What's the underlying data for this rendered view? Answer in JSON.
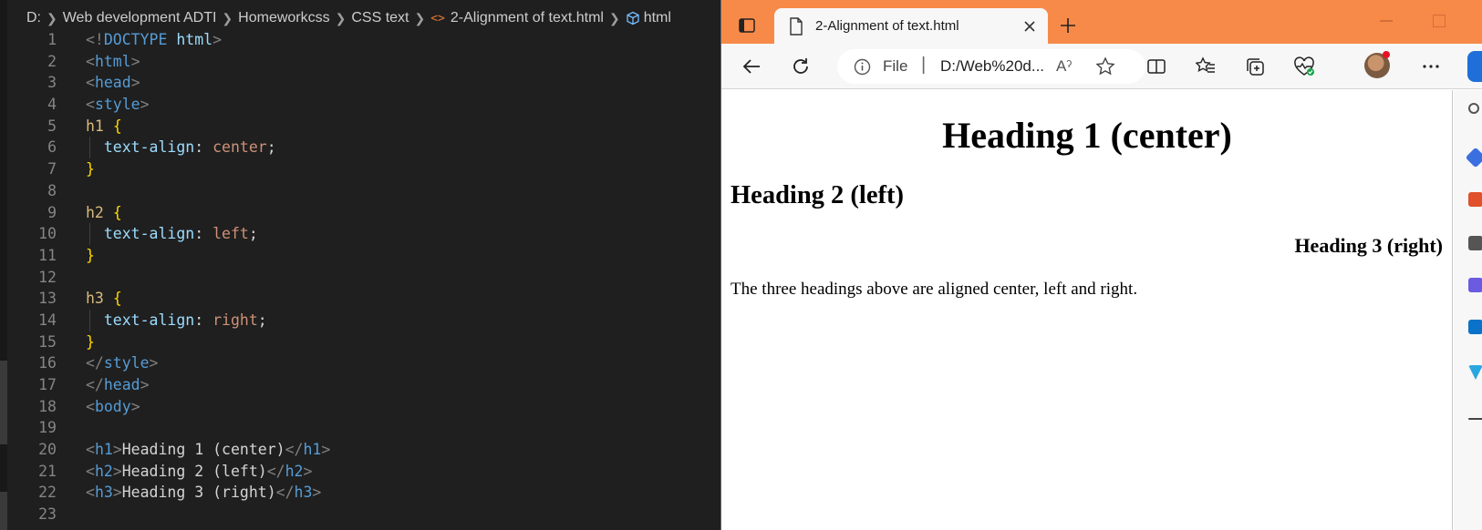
{
  "editor": {
    "breadcrumb": {
      "drive": "D:",
      "folder1": "Web development ADTI",
      "folder2": "Homeworkcss",
      "folder3": "CSS text",
      "file": "2-Alignment of text.html",
      "symbol": "html"
    },
    "code_lines": [
      {
        "n": "1",
        "text": "<!DOCTYPE html>"
      },
      {
        "n": "2",
        "text": "<html>"
      },
      {
        "n": "3",
        "text": "<head>"
      },
      {
        "n": "4",
        "text": "<style>"
      },
      {
        "n": "5",
        "text": "h1 {"
      },
      {
        "n": "6",
        "text": "  text-align: center;"
      },
      {
        "n": "7",
        "text": "}"
      },
      {
        "n": "8",
        "text": ""
      },
      {
        "n": "9",
        "text": "h2 {"
      },
      {
        "n": "10",
        "text": "  text-align: left;"
      },
      {
        "n": "11",
        "text": "}"
      },
      {
        "n": "12",
        "text": ""
      },
      {
        "n": "13",
        "text": "h3 {"
      },
      {
        "n": "14",
        "text": "  text-align: right;"
      },
      {
        "n": "15",
        "text": "}"
      },
      {
        "n": "16",
        "text": "</style>"
      },
      {
        "n": "17",
        "text": "</head>"
      },
      {
        "n": "18",
        "text": "<body>"
      },
      {
        "n": "19",
        "text": ""
      },
      {
        "n": "20",
        "text": "<h1>Heading 1 (center)</h1>"
      },
      {
        "n": "21",
        "text": "<h2>Heading 2 (left)</h2>"
      },
      {
        "n": "22",
        "text": "<h3>Heading 3 (right)</h3>"
      },
      {
        "n": "23",
        "text": ""
      }
    ]
  },
  "browser": {
    "tab_title": "2-Alignment of text.html",
    "address": {
      "scheme_label": "File",
      "separator": "|",
      "url": "D:/Web%20d...",
      "read_aloud": "Aˀ"
    },
    "page": {
      "h1": "Heading 1 (center)",
      "h2": "Heading 2 (left)",
      "h3": "Heading 3 (right)",
      "paragraph": "The three headings above are aligned center, left and right."
    },
    "colors": {
      "titlebar": "#f78a49",
      "toolbar": "#f7f7f7"
    },
    "icons": [
      "tab-actions-icon",
      "page-icon",
      "close-icon",
      "plus-icon",
      "back-icon",
      "refresh-icon",
      "info-icon",
      "star-icon",
      "split-screen-icon",
      "favorites-icon",
      "collections-icon",
      "browser-essentials-icon",
      "profile-avatar",
      "more-icon"
    ]
  }
}
